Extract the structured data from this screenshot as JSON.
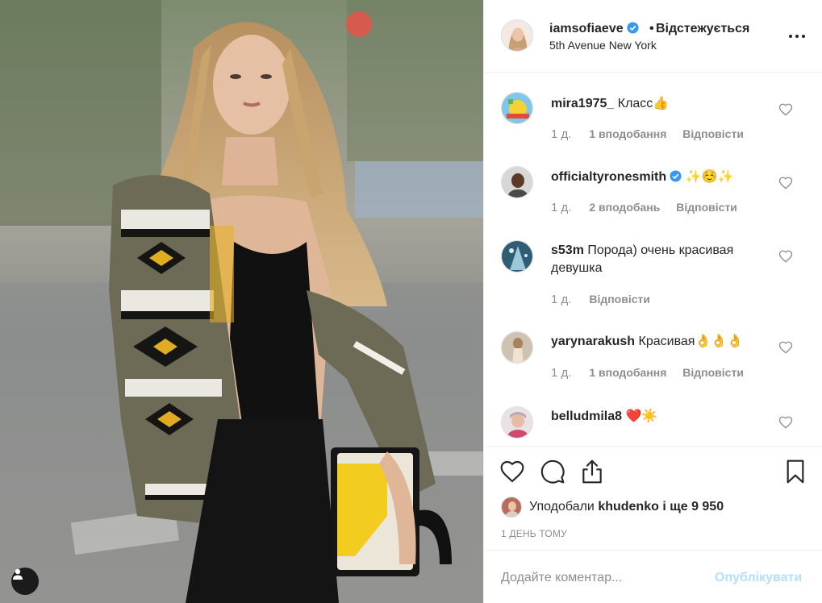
{
  "header": {
    "username": "iamsofiaeve",
    "separator": "•",
    "follow_status": "Відстежується",
    "location": "5th Avenue New York"
  },
  "comments": [
    {
      "username": "mira1975_",
      "text": "Класс👍",
      "time": "1 д.",
      "likes": "1 вподобання",
      "reply": "Відповісти"
    },
    {
      "username": "officialtyronesmith",
      "text": "✨☺️✨",
      "time": "1 д.",
      "likes": "2 вподобань",
      "reply": "Відповісти"
    },
    {
      "username": "s53m",
      "text": "Порода) очень красивая девушка",
      "time": "1 д.",
      "reply": "Відповісти"
    },
    {
      "username": "yarynarakush",
      "text": "Красивая👌👌👌",
      "time": "1 д.",
      "likes": "1 вподобання",
      "reply": "Відповісти"
    },
    {
      "username": "belludmila8",
      "text": "❤️☀️"
    }
  ],
  "likes": {
    "prefix": "Уподобали",
    "user": "khudenko",
    "suffix": "і ще 9 950"
  },
  "time_ago": "1 ДЕНЬ ТОМУ",
  "add_comment": {
    "placeholder": "Додайте коментар...",
    "post_label": "Опублікувати"
  },
  "colors": {
    "verified": "#3897f0",
    "muted_text": "#8e8e8e",
    "post_disabled": "#b2dffc",
    "border": "#efefef"
  }
}
